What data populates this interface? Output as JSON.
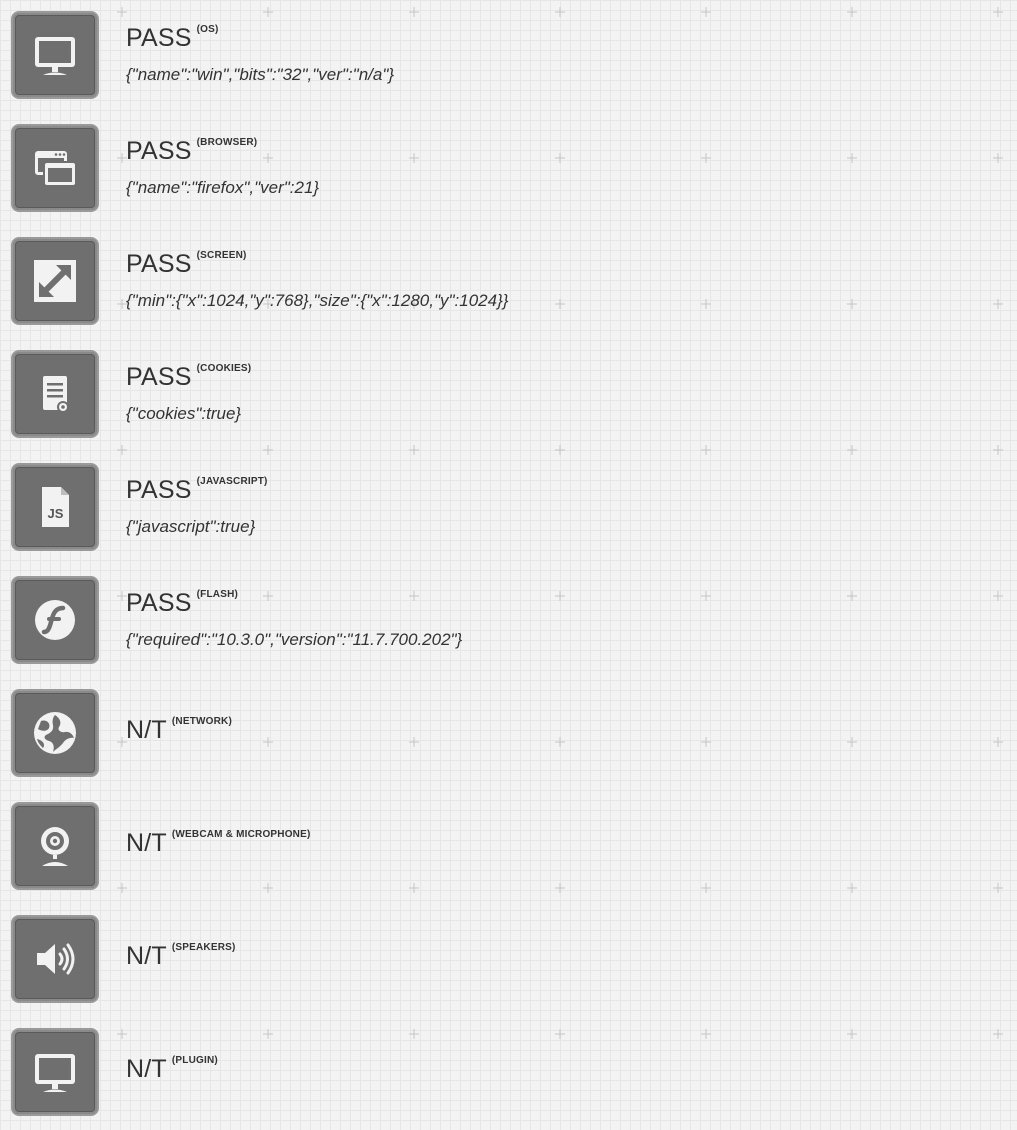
{
  "tests": [
    {
      "status": "PASS",
      "name": "(OS)",
      "detail": "{\"name\":\"win\",\"bits\":\"32\",\"ver\":\"n/a\"}",
      "icon": "monitor-icon"
    },
    {
      "status": "PASS",
      "name": "(BROWSER)",
      "detail": "{\"name\":\"firefox\",\"ver\":21}",
      "icon": "browser-windows-icon"
    },
    {
      "status": "PASS",
      "name": "(SCREEN)",
      "detail": "{\"min\":{\"x\":1024,\"y\":768},\"size\":{\"x\":1280,\"y\":1024}}",
      "icon": "resize-arrow-icon"
    },
    {
      "status": "PASS",
      "name": "(COOKIES)",
      "detail": "{\"cookies\":true}",
      "icon": "cookie-document-icon"
    },
    {
      "status": "PASS",
      "name": "(JAVASCRIPT)",
      "detail": "{\"javascript\":true}",
      "icon": "javascript-file-icon",
      "icon_text": "JS"
    },
    {
      "status": "PASS",
      "name": "(FLASH)",
      "detail": "{\"required\":\"10.3.0\",\"version\":\"11.7.700.202\"}",
      "icon": "flash-icon"
    },
    {
      "status": "N/T",
      "name": "(NETWORK)",
      "icon": "network-globe-icon"
    },
    {
      "status": "N/T",
      "name": "(WEBCAM & MICROPHONE)",
      "icon": "webcam-icon"
    },
    {
      "status": "N/T",
      "name": "(SPEAKERS)",
      "icon": "speaker-icon"
    },
    {
      "status": "N/T",
      "name": "(PLUGIN)",
      "icon": "monitor-icon"
    }
  ],
  "colors": {
    "icon_background": "#6f6f6f",
    "icon_foreground": "#f2f2f2",
    "text": "#333333",
    "page_background": "#f3f3f3"
  }
}
